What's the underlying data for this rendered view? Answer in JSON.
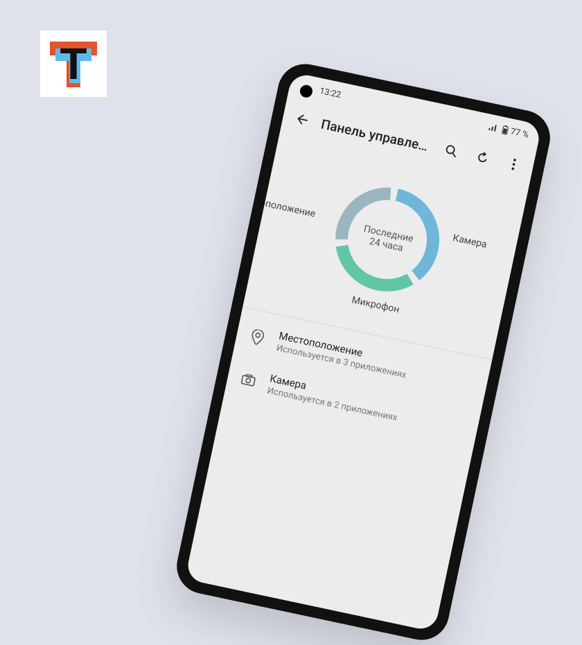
{
  "logo": {
    "glyph": "T"
  },
  "statusbar": {
    "time": "13:22",
    "battery_label": "77 %"
  },
  "appbar": {
    "title": "Панель управле…"
  },
  "donut": {
    "center_line1": "Последние",
    "center_line2": "24 часа",
    "labels": {
      "location": "естоположение",
      "camera": "Камера",
      "microphone": "Микрофон"
    }
  },
  "list": {
    "items": [
      {
        "title": "Местоположение",
        "subtitle": "Используется в 3 приложениях",
        "icon": "location"
      },
      {
        "title": "Камера",
        "subtitle": "Используется в 2 приложениях",
        "icon": "camera"
      }
    ]
  },
  "chart_data": {
    "type": "pie",
    "title": "Последние 24 часа",
    "series": [
      {
        "name": "Местоположение",
        "value": 36,
        "color": "#70b6d9"
      },
      {
        "name": "Микрофон",
        "value": 31,
        "color": "#60c6a6"
      },
      {
        "name": "Камера",
        "value": 26,
        "color": "#9bb6c0"
      }
    ],
    "note": "Values are approximate shares of the ring, read from arc lengths; gaps between segments account for the remainder."
  }
}
